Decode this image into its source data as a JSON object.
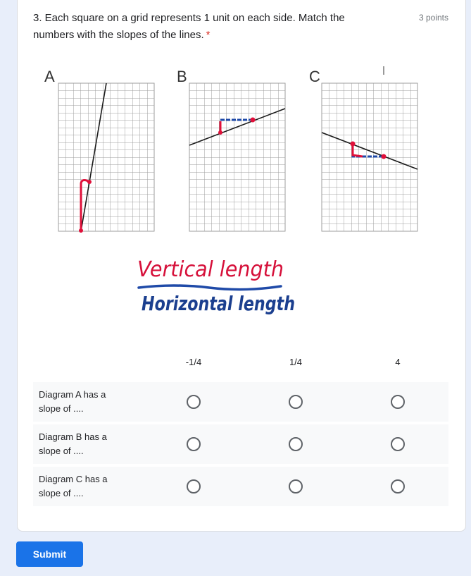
{
  "question": {
    "title": "3. Each square on a grid represents 1 unit on each side. Match the numbers with the slopes of the lines.",
    "required_marker": "*",
    "points": "3 points"
  },
  "figure": {
    "panels": [
      "A",
      "B",
      "C"
    ],
    "numerator_text": "Vertical length",
    "denominator_text": "Horizontal length",
    "colors": {
      "grid": "#9e9e9e",
      "line": "#1a1a1a",
      "red": "#e0103a",
      "blue": "#1f4aa8"
    }
  },
  "grid": {
    "columns": [
      "-1/4",
      "1/4",
      "4"
    ],
    "rows": [
      {
        "label": "Diagram A has a slope of ...."
      },
      {
        "label": "Diagram B has a slope of ...."
      },
      {
        "label": "Diagram C has a slope of ...."
      }
    ]
  },
  "submit_label": "Submit",
  "colors": {
    "accent": "#1a73e8",
    "background": "#e8eefa",
    "required": "#d93025"
  }
}
